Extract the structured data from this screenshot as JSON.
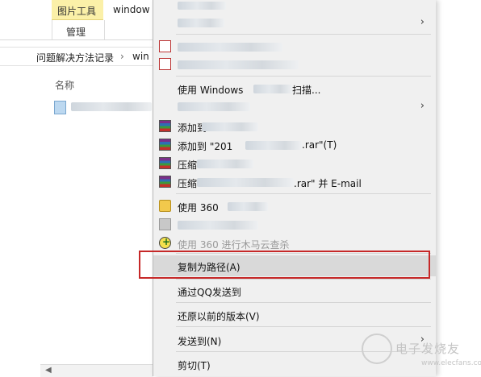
{
  "explorer": {
    "ribbon_tab_group": "图片工具",
    "ribbon_subtab": "管理",
    "window_title": "window",
    "address_segment_1": "问题解决方法记录",
    "address_separator": "›",
    "address_segment_2": "win",
    "column_header": "名称"
  },
  "context_menu": {
    "items": [
      {
        "label": "打开方式(H)",
        "arrow": "›"
      },
      {
        "label": "使用 Windows",
        "suffix": "扫描..."
      },
      {
        "label": "授予访问权限(G)",
        "arrow": "›"
      },
      {
        "label": "添加到"
      },
      {
        "label": "添加到 \"201",
        "suffix": ".rar\"(T)"
      },
      {
        "label": "压缩"
      },
      {
        "label": "压缩",
        "suffix": ".rar\" 并 E-mail"
      },
      {
        "label": "使用 360"
      },
      {
        "label": "使用 360 进行木马云查杀"
      },
      {
        "label": "复制为路径(A)"
      },
      {
        "label": "通过QQ发送到"
      },
      {
        "label": "还原以前的版本(V)"
      },
      {
        "label": "发送到(N)",
        "arrow": "›"
      },
      {
        "label": "剪切(T)"
      }
    ]
  },
  "watermark": {
    "text": "电子发烧友",
    "url": "www.elecfans.com"
  },
  "colors": {
    "highlight_border": "#c62828",
    "ribbon_tab": "#fbf0a8",
    "menu_bg": "#f0f0f0"
  }
}
